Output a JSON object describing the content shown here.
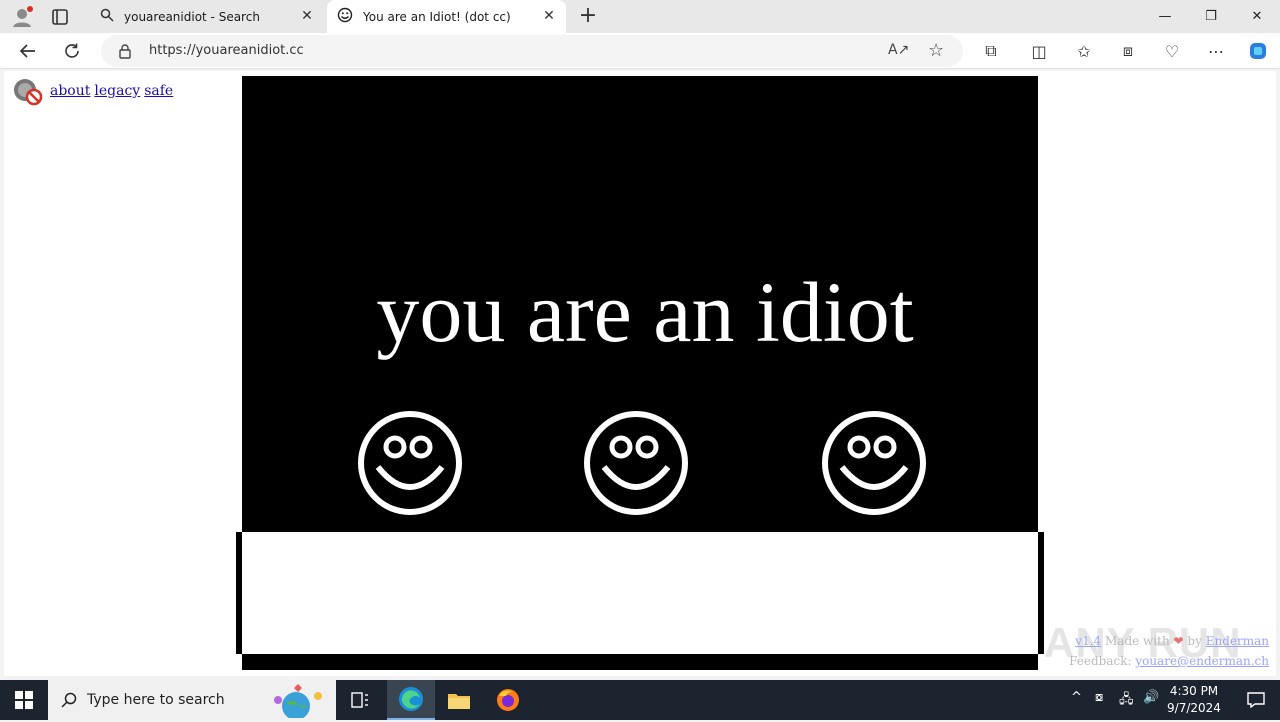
{
  "browser": {
    "tabs": [
      {
        "label": "youareanidiot - Search",
        "icon": "search-icon"
      },
      {
        "label": "You are an Idiot! (dot cc)",
        "icon": "smiley-icon"
      }
    ],
    "url": "https://youareanidiot.cc"
  },
  "page": {
    "links": [
      "about",
      "legacy",
      "safe"
    ],
    "headline": "you are an idiot",
    "footer": {
      "version": "v1.4",
      "made_with": "Made with",
      "by": "by",
      "author": "Enderman",
      "feedback_label": "Feedback:",
      "feedback_email": "youare@enderman.ch"
    },
    "watermark": "ANY RUN"
  },
  "taskbar": {
    "search_placeholder": "Type here to search",
    "time": "4:30 PM",
    "date": "9/7/2024"
  },
  "colors": {
    "accent": "#1a73e8",
    "page_black": "#000000",
    "taskbar_bg": "#1c2430"
  }
}
